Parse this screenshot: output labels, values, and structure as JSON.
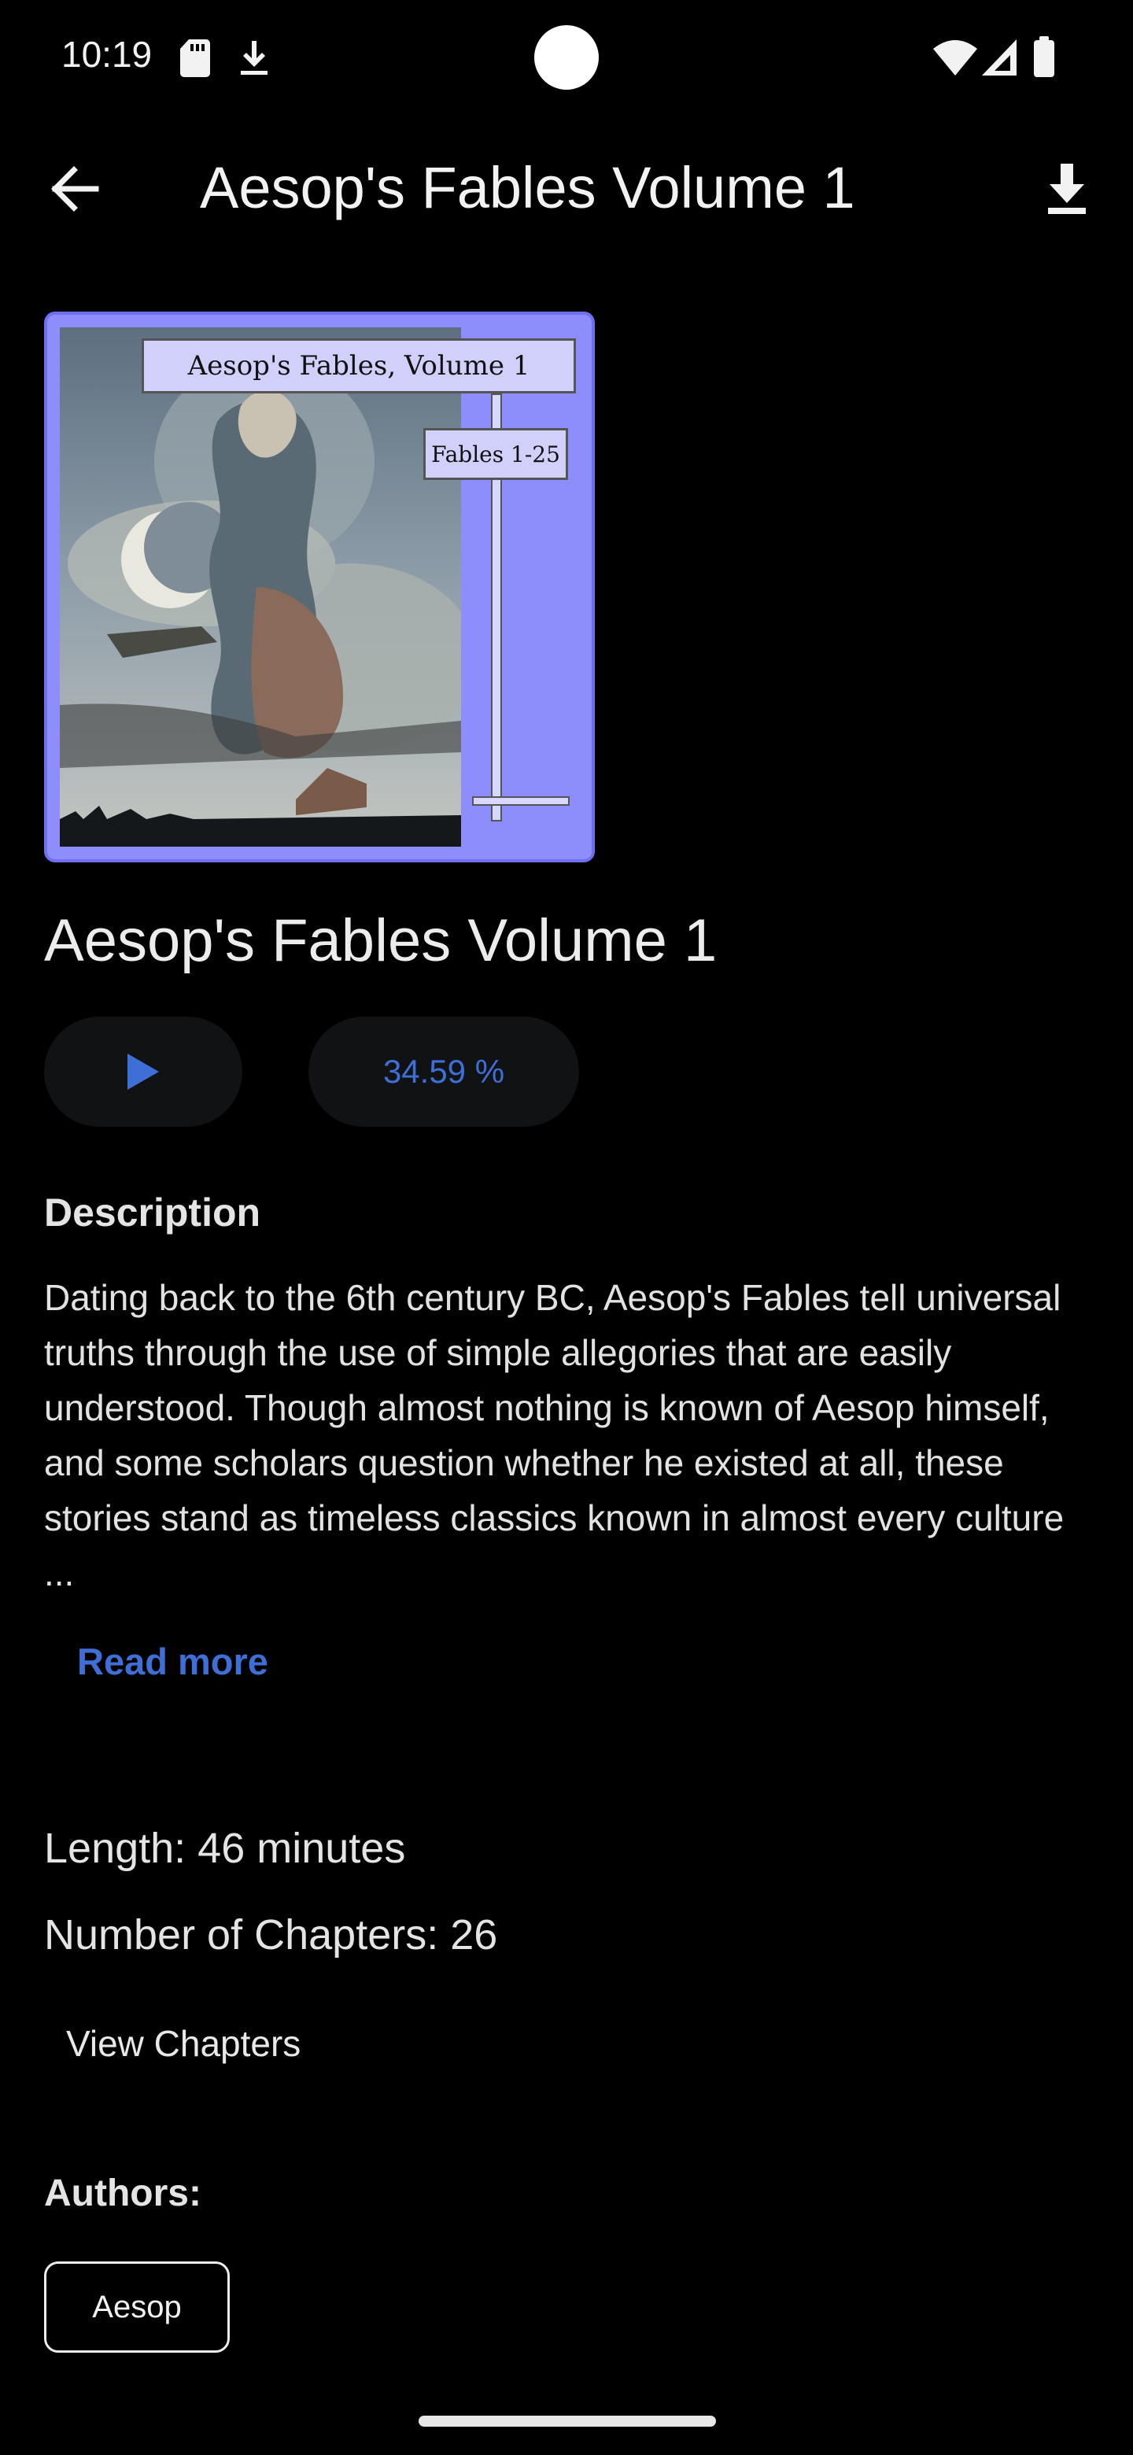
{
  "status_bar": {
    "time": "10:19",
    "left_icons": [
      "sd-card-icon",
      "download-icon"
    ],
    "right_icons": [
      "wifi-icon",
      "signal-icon",
      "battery-icon"
    ]
  },
  "app_bar": {
    "back_icon": "arrow-back-icon",
    "title": "Aesop's Fables Volume 1",
    "action_icon": "download-icon"
  },
  "cover": {
    "title_text": "Aesop's Fables, Volume 1",
    "subtitle_text": "Fables 1-25",
    "frame_color": "#8d8dfb"
  },
  "book": {
    "title": "Aesop's Fables Volume 1",
    "play_icon": "play-icon",
    "progress": "34.59 %"
  },
  "description": {
    "heading": "Description",
    "text": "Dating back to the 6th century BC, Aesop's Fables tell universal truths through the use of simple allegories that are easily understood. Though almost nothing is known of Aesop himself, and some scholars question whether he existed at all, these stories stand as timeless classics known in almost every culture ...",
    "read_more": "Read more"
  },
  "details": {
    "length": "Length: 46 minutes",
    "chapters": "Number of Chapters: 26",
    "view_chapters": "View Chapters"
  },
  "authors": {
    "heading": "Authors:",
    "items": [
      "Aesop"
    ]
  },
  "colors": {
    "background": "#000000",
    "accent": "#3d6fd6",
    "surface": "#111214"
  }
}
